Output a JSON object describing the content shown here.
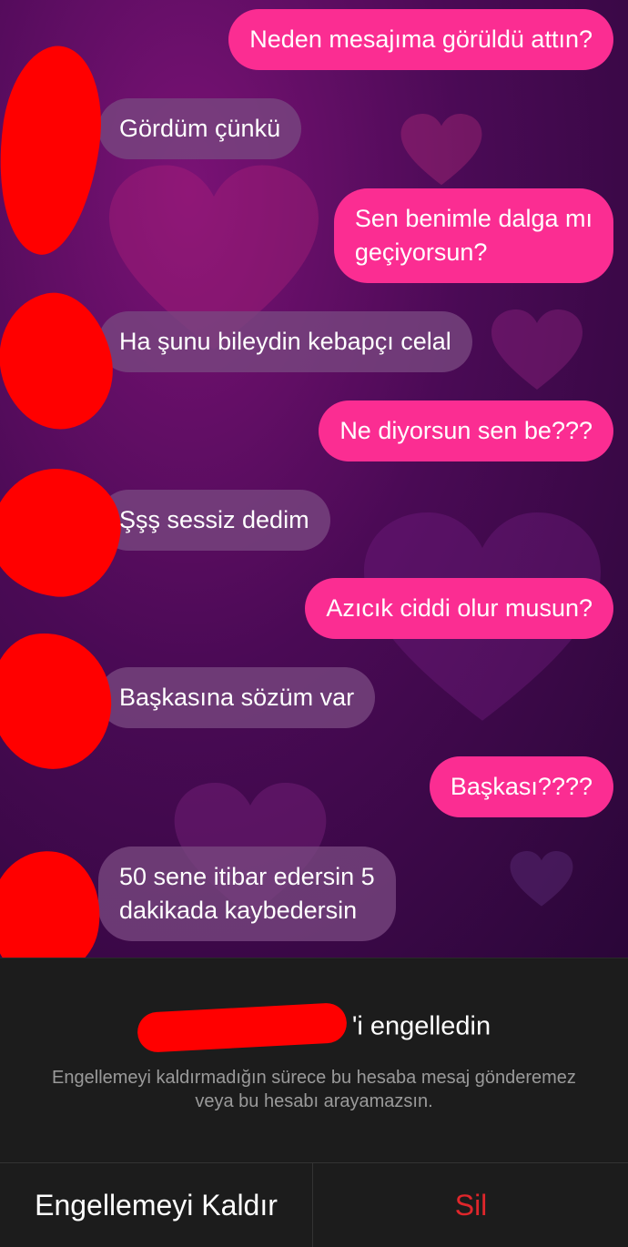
{
  "chat": {
    "messages": [
      {
        "dir": "out",
        "text": "Neden mesajıma görüldü attın?"
      },
      {
        "dir": "in",
        "text": "Gördüm çünkü"
      },
      {
        "dir": "out",
        "text": "Sen benimle dalga mı\ngeçiyorsun?"
      },
      {
        "dir": "in",
        "text": "Ha şunu bileydin kebapçı celal"
      },
      {
        "dir": "out",
        "text": "Ne diyorsun sen be???"
      },
      {
        "dir": "in",
        "text": "Şşş sessiz dedim"
      },
      {
        "dir": "out",
        "text": "Azıcık ciddi olur musun?"
      },
      {
        "dir": "in",
        "text": "Başkasına sözüm var"
      },
      {
        "dir": "out",
        "text": "Başkası????"
      },
      {
        "dir": "in",
        "text": "50 sene itibar edersin 5\ndakikada kaybedersin"
      }
    ]
  },
  "blocked": {
    "title_suffix": "'i engelledin",
    "description": "Engellemeyi kaldırmadığın sürece bu hesaba mesaj gönderemez veya bu hesabı arayamazsın."
  },
  "actions": {
    "unblock_label": "Engellemeyi Kaldır",
    "delete_label": "Sil"
  },
  "colors": {
    "outgoing_bubble": "#fb2d92",
    "incoming_bubble": "#6e4477",
    "delete_text": "#e0262b",
    "panel_bg": "#1c1c1c"
  }
}
